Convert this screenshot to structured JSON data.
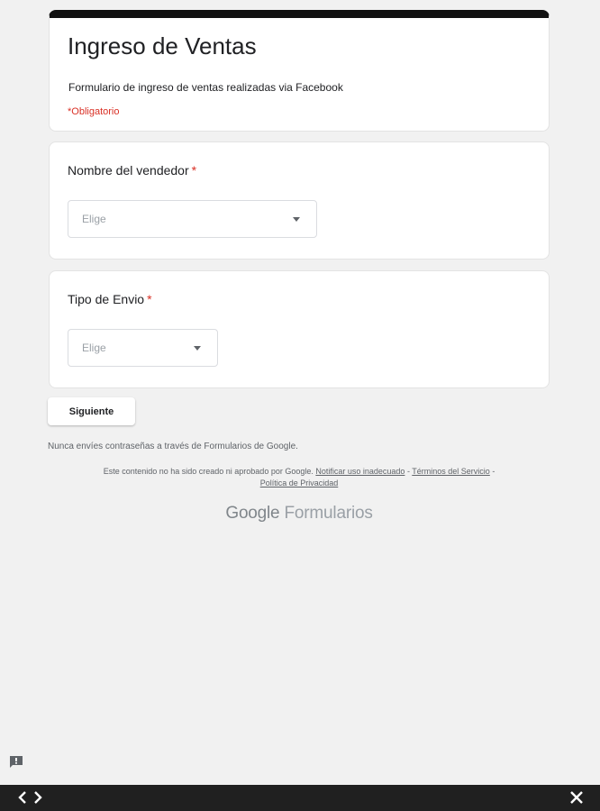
{
  "form": {
    "title": "Ingreso de Ventas",
    "description": "Formulario de ingreso de ventas realizadas via Facebook",
    "required_note": "*Obligatorio"
  },
  "questions": [
    {
      "label": "Nombre del vendedor",
      "required_mark": "*",
      "select_value": "Elige"
    },
    {
      "label": "Tipo de Envio",
      "required_mark": "*",
      "select_value": "Elige"
    }
  ],
  "actions": {
    "next_label": "Siguiente"
  },
  "footer": {
    "password_warning": "Nunca envíes contraseñas a través de Formularios de Google.",
    "disclaimer_text": "Este contenido no ha sido creado ni aprobado por Google.",
    "report_link": "Notificar uso inadecuado",
    "separator_1": " - ",
    "terms_link": "Términos del Servicio",
    "separator_2": " - ",
    "privacy_link": "Política de Privacidad",
    "brand_google": "Google",
    "brand_product": "Formularios"
  },
  "icons": {
    "report": "feedback-icon",
    "prev": "chevron-left-icon",
    "next": "chevron-right-icon",
    "close": "close-icon"
  },
  "colors": {
    "background": "#f1f1f1",
    "header_bar": "#111111",
    "required": "#d93025",
    "bottom_bar": "#202020"
  }
}
